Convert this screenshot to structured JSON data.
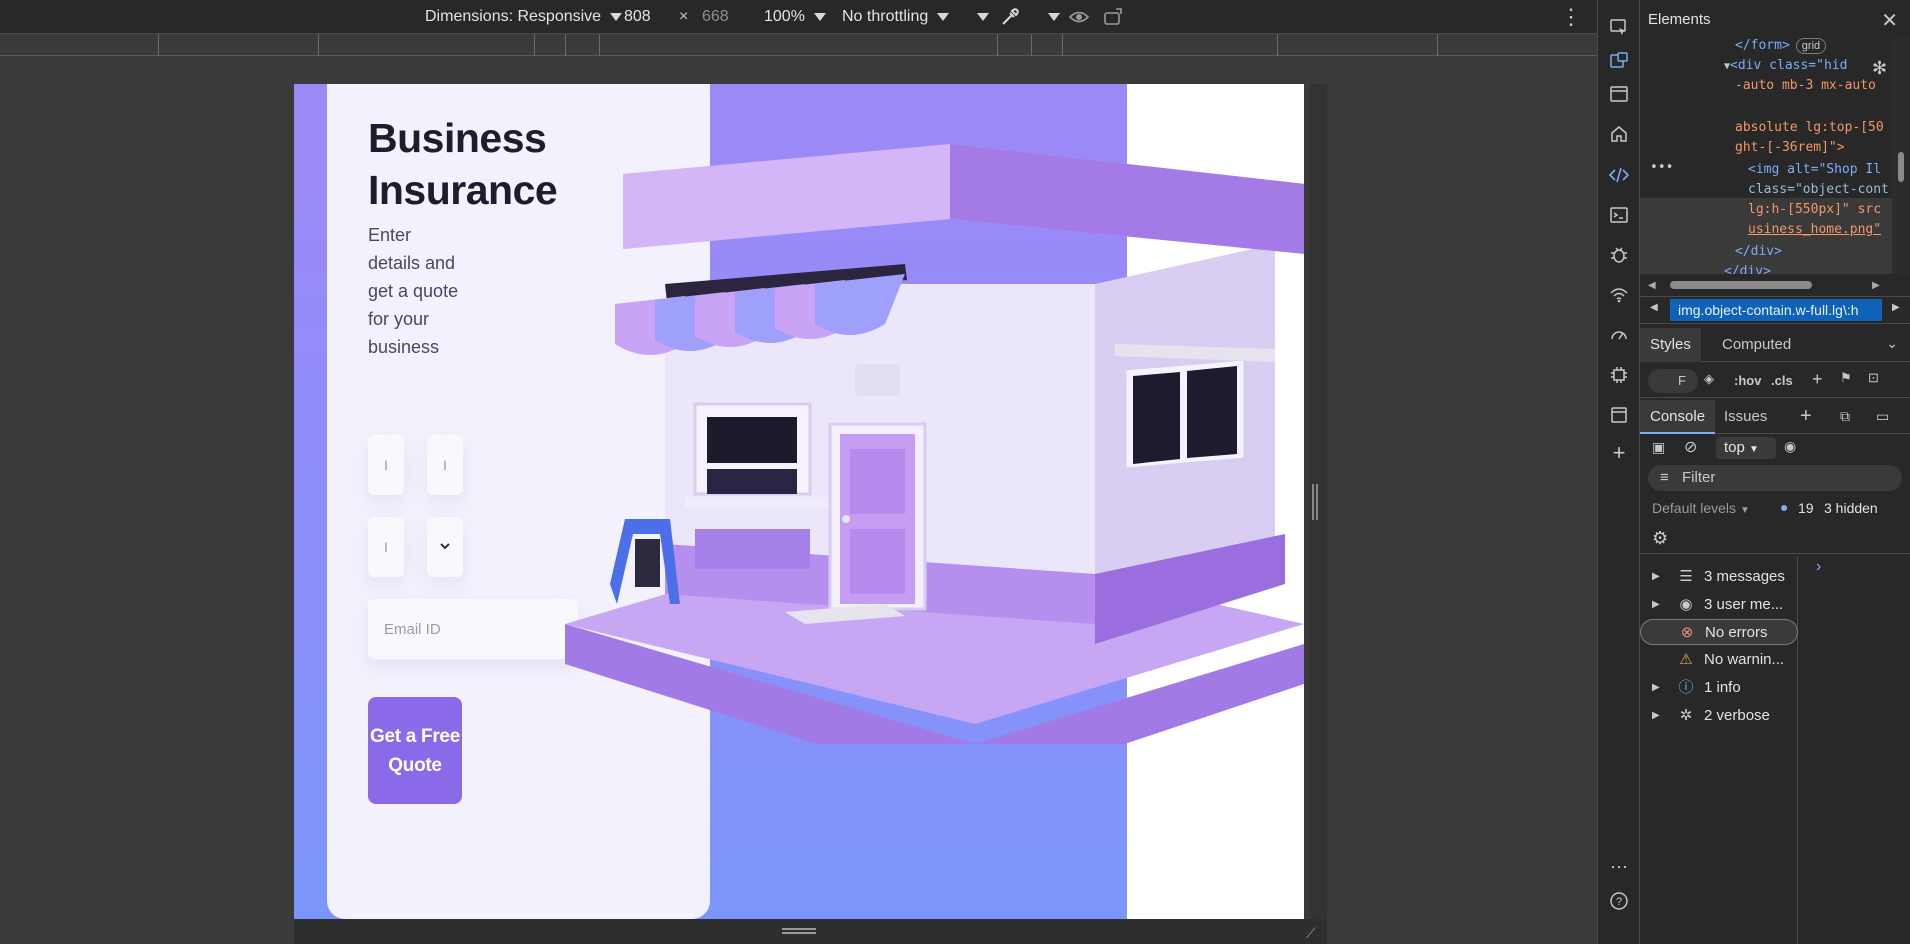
{
  "device_toolbar": {
    "dimensions_label": "Dimensions: Responsive",
    "width_value": "808",
    "times": "×",
    "height_value": "668",
    "zoom": "100%",
    "throttling": "No throttling"
  },
  "page": {
    "title": "Business Insurance",
    "subtitle": "Enter details and get a quote for your business",
    "field_placeholders": [
      "I",
      "I",
      "I"
    ],
    "email_placeholder": "Email ID",
    "cta_label": "Get a Free Quote",
    "colors": {
      "accent": "#8b6ae9",
      "gradient_top": "#9d88f7",
      "gradient_bottom": "#7b96fb",
      "card": "#f2f1fc"
    }
  },
  "devtools": {
    "panel_title": "Elements",
    "code_lines": [
      {
        "text": "</form>",
        "badge": "grid"
      },
      {
        "text": "<div class=\"hid"
      },
      {
        "text": "-auto mb-3 mx-auto"
      },
      {
        "text": ""
      },
      {
        "text": "absolute lg:top-[50"
      },
      {
        "text": "ght-[-36rem]\">"
      },
      {
        "text": "<img alt=\"Shop Il"
      },
      {
        "text": "class=\"object-cont"
      },
      {
        "text": "lg:h-[550px]\" src"
      },
      {
        "text": "usiness_home.png\""
      },
      {
        "text": "</div>"
      },
      {
        "text": "</div>"
      }
    ],
    "breadcrumb": "img.object-contain.w-full.lg\\:h",
    "style_tabs": [
      "Styles",
      "Computed"
    ],
    "style_tools": {
      "filter_label": "F",
      "hov": ":hov",
      "cls": ".cls"
    },
    "drawer_tabs": [
      "Console",
      "Issues"
    ],
    "context": "top",
    "filter_placeholder": "Filter",
    "levels": "Default levels",
    "message_count": "19",
    "hidden_count": "3 hidden",
    "sidebar": [
      {
        "label": "3 messages",
        "icon": "list-icon",
        "expandable": true
      },
      {
        "label": "3 user me...",
        "icon": "user-icon",
        "expandable": true
      },
      {
        "label": "No errors",
        "icon": "error-icon",
        "expandable": false,
        "selected": true
      },
      {
        "label": "No warnin...",
        "icon": "warning-icon",
        "expandable": false
      },
      {
        "label": "1 info",
        "icon": "info-icon",
        "expandable": true
      },
      {
        "label": "2 verbose",
        "icon": "bug-icon",
        "expandable": true
      }
    ],
    "status_colors": {
      "error": "#f28b82",
      "warning": "#e8a24a",
      "info": "#7cacf8"
    }
  }
}
